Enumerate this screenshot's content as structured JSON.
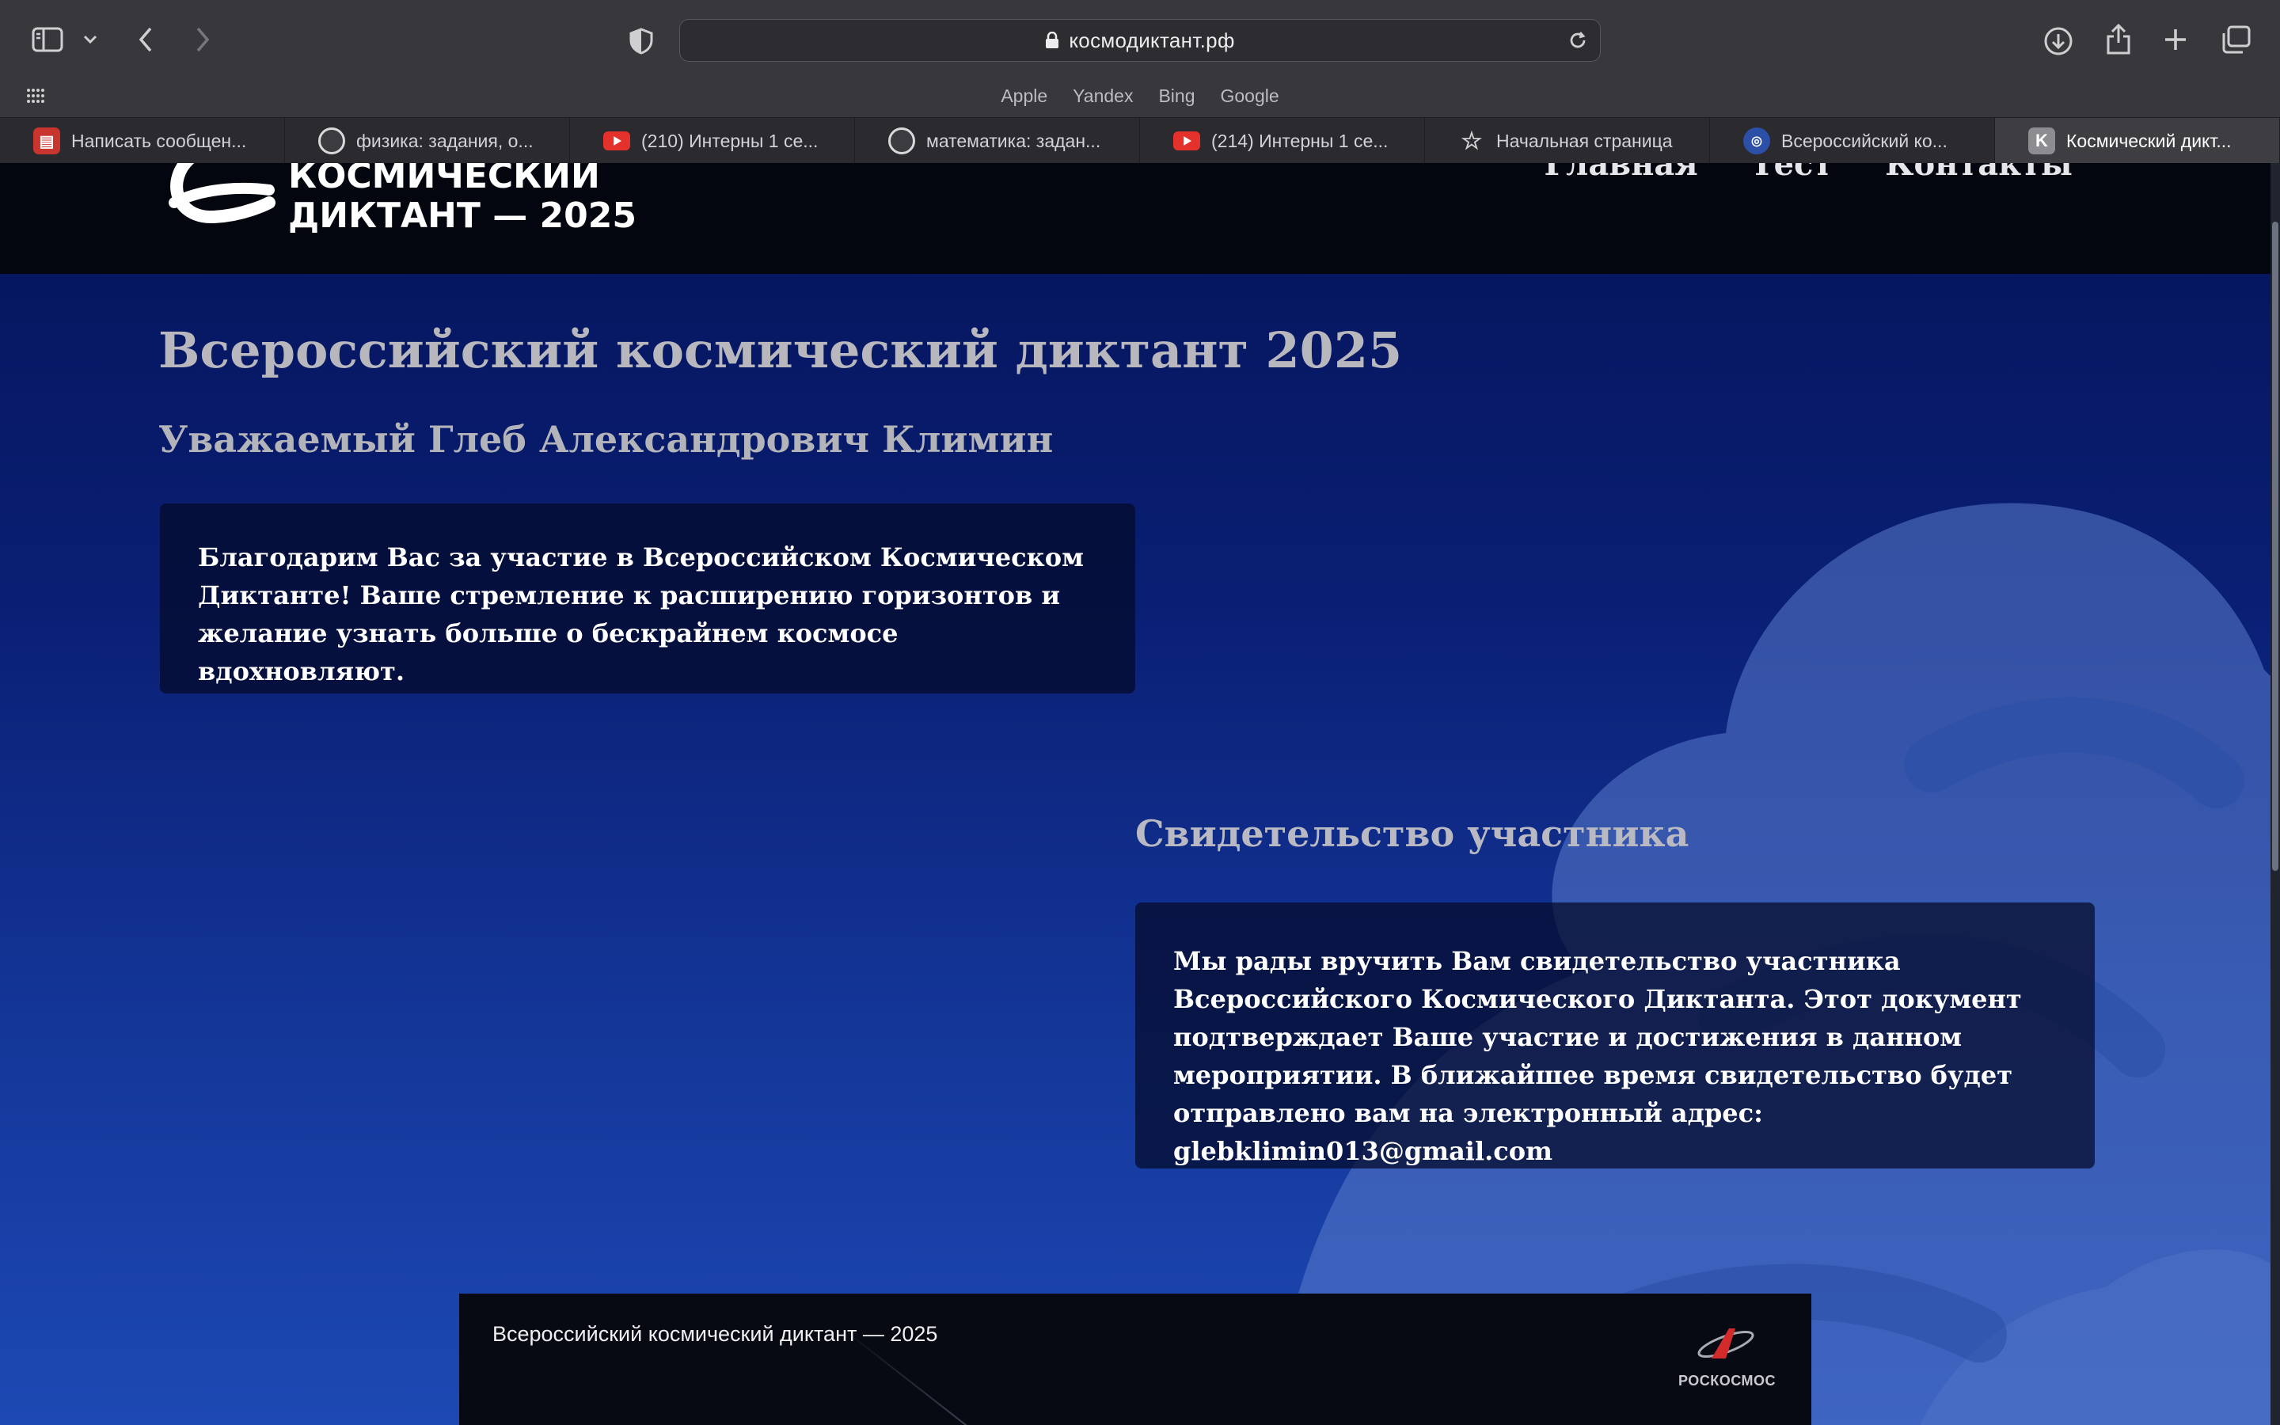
{
  "browser": {
    "url": "космодиктант.рф",
    "favorites": [
      "Apple",
      "Yandex",
      "Bing",
      "Google"
    ],
    "tabs": [
      {
        "label": "Написать сообщен...",
        "icon": "document-icon"
      },
      {
        "label": "физика: задания, о...",
        "icon": "spiral-icon"
      },
      {
        "label": "(210) Интерны 1 се...",
        "icon": "youtube-icon"
      },
      {
        "label": "математика: задан...",
        "icon": "spiral-icon"
      },
      {
        "label": "(214) Интерны 1 се...",
        "icon": "youtube-icon"
      },
      {
        "label": "Начальная страница",
        "icon": "star-icon"
      },
      {
        "label": "Всероссийский ко...",
        "icon": "globe-icon"
      },
      {
        "label": "Космический дикт...",
        "icon": "k-icon",
        "favicon_letter": "K",
        "active": true
      }
    ]
  },
  "header": {
    "logo_line1": "КОСМИЧЕСКИЙ",
    "logo_line2": "ДИКТАНТ — 2025",
    "nav": [
      "Главная",
      "Тест",
      "Контакты"
    ]
  },
  "main": {
    "title": "Всероссийский космический диктант 2025",
    "greeting": "Уважаемый Глеб Александрович Климин",
    "thanks_text": "Благодарим Вас за участие в Всероссийском Космическом Диктанте! Ваше стремление к расширению горизонтов и желание узнать больше о бескрайнем космосе вдохновляют.",
    "certificate_title": "Свидетельство участника",
    "certificate_text": "Мы рады вручить Вам свидетельство участника Всероссийского Космического Диктанта. Этот документ подтверждает Ваше участие и достижения в данном мероприятии. В ближайшее время свидетельство будет отправлено вам на электронный адрес:",
    "email": "glebklimin013@gmail.com"
  },
  "footer": {
    "text": "Всероссийский космический диктант — 2025",
    "brand": "РОСКОСМОС"
  },
  "colors": {
    "page_gradient_top": "#05145a",
    "page_gradient_bottom": "#1d49b4",
    "header_bg": "#03060f",
    "title_color": "#b7b7bd"
  }
}
